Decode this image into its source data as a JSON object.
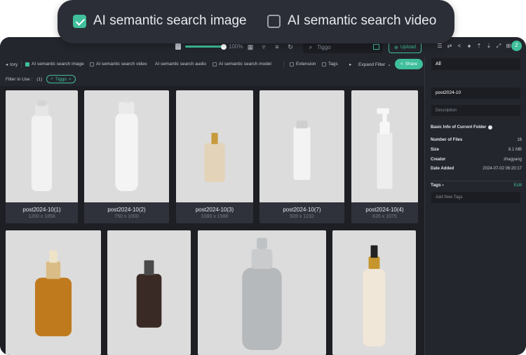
{
  "header": {
    "opt_image": "AI semantic search image",
    "opt_video": "AI semantic search video",
    "image_checked": true,
    "video_checked": false
  },
  "toolbar": {
    "zoom": "100%",
    "search_placeholder": "Tiggo",
    "upload_label": "Upload",
    "avatar_initial": "Z"
  },
  "filters": {
    "history": "tory",
    "ai_image": "AI semantic search image",
    "ai_video": "AI semantic search video",
    "ai_audio": "AI semantic search audio",
    "ai_model": "AI semantic search model",
    "extension": "Extension",
    "tags": "Tags",
    "expand": "Expand Filter",
    "share": "Share",
    "in_use_label": "Filter in Use :",
    "in_use_count": "(1)",
    "chip": "Tiggo"
  },
  "files": [
    {
      "name": "post2024-10(1)",
      "dims": "1200 x 1858",
      "type": "spray-can"
    },
    {
      "name": "post2024-10(2)",
      "dims": "750 x 1000",
      "type": "spray-tall"
    },
    {
      "name": "post2024-10(3)",
      "dims": "1080 x 1588",
      "type": "perfume"
    },
    {
      "name": "post2024-10(7)",
      "dims": "928 x 1232",
      "type": "spray-small"
    },
    {
      "name": "post2024-10(4)",
      "dims": "635 x 1075",
      "type": "foam-pump"
    },
    {
      "name": "",
      "dims": "",
      "type": "amber-pump"
    },
    {
      "name": "",
      "dims": "",
      "type": "dark-bottle"
    },
    {
      "name": "",
      "dims": "",
      "type": "metal-spray"
    },
    {
      "name": "",
      "dims": "",
      "type": "clear-spray"
    }
  ],
  "panel": {
    "scope": "All",
    "folder_name": "post2024-10",
    "description_placeholder": "Description",
    "basic_info": "Basic Info of Current Folder",
    "number_of_files_label": "Number of Files",
    "number_of_files": "16",
    "size_label": "Size",
    "size": "8.1 MB",
    "creator_label": "Creator",
    "creator": "zhagyang",
    "date_added_label": "Date Added",
    "date_added": "2024-07-02 06:20:17",
    "tags_label": "Tags",
    "edit_label": "Edit",
    "add_tags_placeholder": "Add New Tags"
  }
}
